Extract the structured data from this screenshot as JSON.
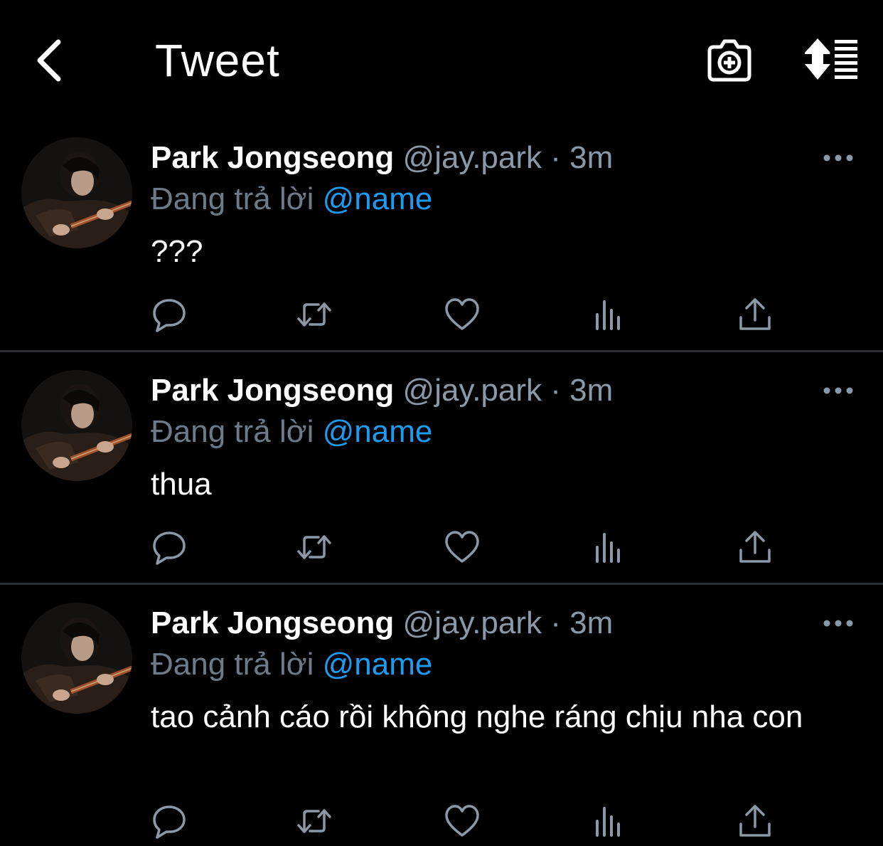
{
  "header": {
    "title": "Tweet",
    "back_icon": "chevron-left-icon",
    "camera_icon": "camera-add-icon",
    "sort_icon": "sort-icon"
  },
  "colors": {
    "background": "#000000",
    "text_primary": "#ffffff",
    "text_secondary": "#8b98a5",
    "accent": "#1d9bf0",
    "divider": "#2a2e33"
  },
  "tweets": [
    {
      "author_name": "Park Jongseong",
      "handle_time": "@jay.park · 3m",
      "reply_prefix": "Đang trả lời",
      "reply_to": "@name",
      "text": "???"
    },
    {
      "author_name": "Park Jongseong",
      "handle_time": "@jay.park · 3m",
      "reply_prefix": "Đang trả lời",
      "reply_to": "@name",
      "text": "thua"
    },
    {
      "author_name": "Park Jongseong",
      "handle_time": "@jay.park · 3m",
      "reply_prefix": "Đang trả lời",
      "reply_to": "@name",
      "text": "tao cảnh cáo rồi không nghe ráng chịu nha con"
    }
  ],
  "action_icons": [
    "reply-icon",
    "retweet-icon",
    "like-icon",
    "analytics-icon",
    "share-icon"
  ]
}
